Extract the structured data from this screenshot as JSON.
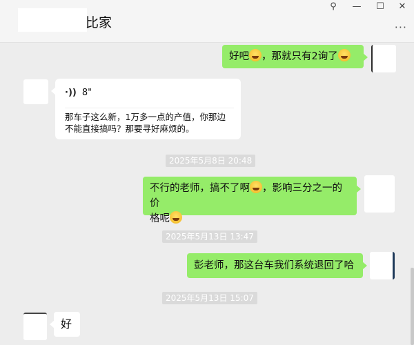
{
  "window": {
    "title": "比家",
    "pin_glyph": "⚲",
    "minimize_glyph": "—",
    "maximize_glyph": "☐",
    "close_glyph": "✕",
    "more_glyph": "···"
  },
  "messages": {
    "m1": {
      "text_a": "好吧",
      "text_b": "，那就只有2询了"
    },
    "m2": {
      "voice_icon": "·))",
      "voice_duration": "8\"",
      "transcript": "那车子这么新，1万多一点的产值，你那边不能直接搞吗？那要寻好麻烦的。"
    },
    "ts1": "2025年5月8日 20:48",
    "m3": {
      "line1_a": "不行的老师，搞不了啊",
      "line1_b": "，影响三分之一的价",
      "line2": "格呢"
    },
    "ts2": "2025年5月13日 13:47",
    "m4": {
      "text": "彭老师，那这台车我们系统退回了哈"
    },
    "ts3": "2025年5月13日 15:07",
    "m5": {
      "text": "好"
    }
  },
  "colors": {
    "my_bubble": "#95ec69",
    "their_bubble": "#ffffff",
    "chat_background": "#ededed"
  }
}
